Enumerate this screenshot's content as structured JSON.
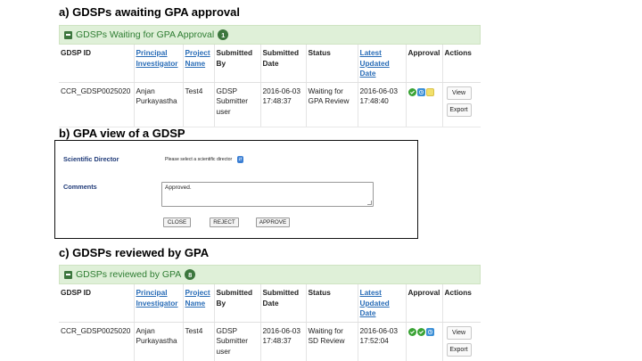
{
  "sections": {
    "a_heading": "a) GDSPs awaiting GPA approval",
    "b_heading": "b) GPA view of a GDSP",
    "c_heading": "c) GDSPs reviewed by GPA"
  },
  "panel_a": {
    "title": "GDSPs Waiting for GPA Approval",
    "count": "1",
    "columns": [
      "GDSP ID",
      "Principal Investigator",
      "Project Name",
      "Submitted By",
      "Submitted Date",
      "Status",
      "Latest Updated Date",
      "Approval",
      "Actions"
    ],
    "row": {
      "gdsp_id": "CCR_GDSP0025020",
      "pi": "Anjan Purkayastha",
      "project": "Test4",
      "submitted_by": "GDSP Submitter user",
      "submitted_date": "2016-06-03 17:48:37",
      "status": "Waiting for GPA Review",
      "updated": "2016-06-03 17:48:40",
      "view_label": "View",
      "export_label": "Export"
    }
  },
  "gpa_view": {
    "director_label": "Scientific Director",
    "director_placeholder": "Please select a scientific director",
    "comments_label": "Comments",
    "comments_value": "Approved.",
    "close_label": "CLOSE",
    "reject_label": "REJECT",
    "approve_label": "APPROVE"
  },
  "panel_c": {
    "title": "GDSPs reviewed by GPA",
    "count": "8",
    "columns": [
      "GDSP ID",
      "Principal Investigator",
      "Project Name",
      "Submitted By",
      "Submitted Date",
      "Status",
      "Latest Updated Date",
      "Approval",
      "Actions"
    ],
    "row": {
      "gdsp_id": "CCR_GDSP0025020",
      "pi": "Anjan Purkayastha",
      "project": "Test4",
      "submitted_by": "GDSP Submitter user",
      "submitted_date": "2016-06-03 17:48:37",
      "status": "Waiting for SD Review",
      "updated": "2016-06-03 17:52:04",
      "view_label": "View",
      "export_label": "Export"
    }
  },
  "colors": {
    "header_bg": "#dff0d8",
    "header_text": "#2e7d32",
    "link": "#2a6db7",
    "label_blue": "#1f3a78"
  },
  "icons": {
    "approve": "check-circle-icon",
    "pending": "clock-icon",
    "waiting": "square-icon"
  }
}
